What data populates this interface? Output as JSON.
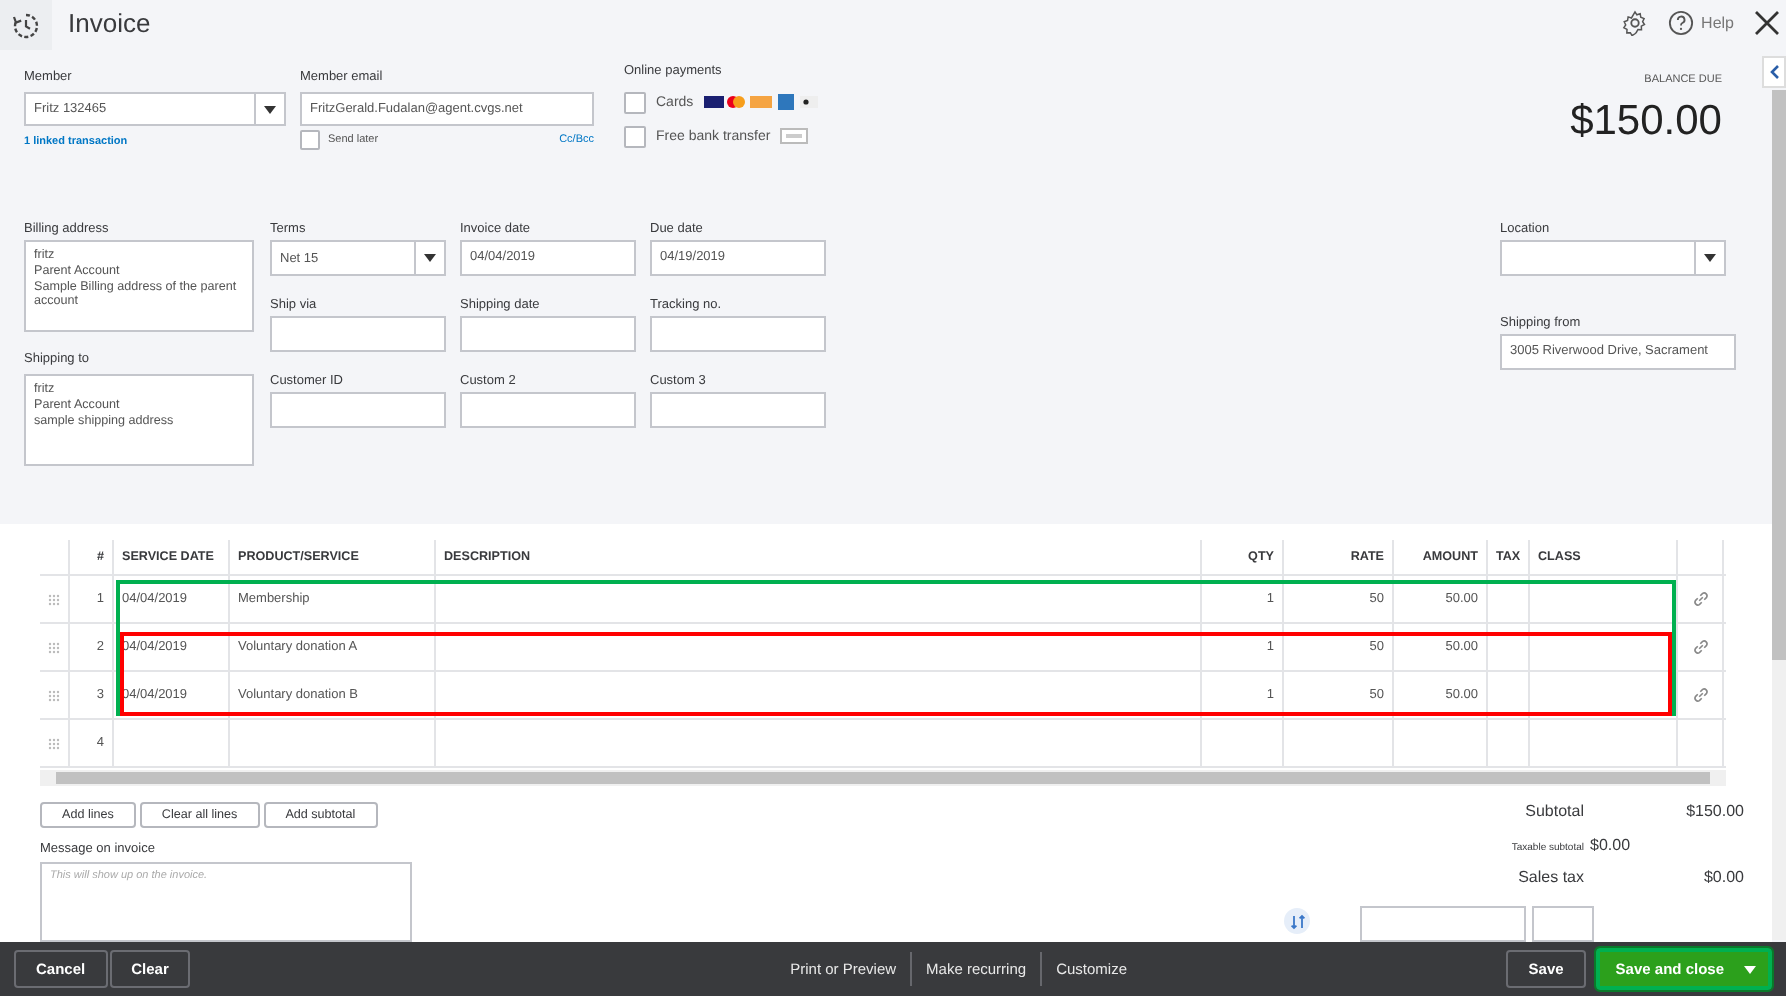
{
  "header": {
    "title": "Invoice",
    "help": "Help"
  },
  "member": {
    "label": "Member",
    "value": "Fritz 132465",
    "link": "1 linked transaction"
  },
  "email": {
    "label": "Member email",
    "value": "FritzGerald.Fudalan@agent.cvgs.net",
    "send_later": {
      "label": "Send later",
      "checked": false
    },
    "cc_link": "Cc/Bcc"
  },
  "online_payments": {
    "label": "Online payments",
    "options": [
      {
        "label": "Cards",
        "checked": false,
        "kind": "cards"
      },
      {
        "label": "Free bank transfer",
        "checked": false,
        "kind": "bank"
      }
    ]
  },
  "balance_due": {
    "label": "BALANCE DUE",
    "amount": "$150.00"
  },
  "billing_address": {
    "label": "Billing address",
    "lines": [
      "fritz",
      "Parent Account",
      "Sample Billing address of the parent account"
    ]
  },
  "shipping_to": {
    "label": "Shipping to",
    "lines": [
      "fritz",
      "Parent Account",
      "sample shipping address"
    ]
  },
  "fields": [
    {
      "label": "Terms",
      "value": "Net 15",
      "kind": "dropdown"
    },
    {
      "label": "Invoice date",
      "value": "04/04/2019",
      "kind": "text"
    },
    {
      "label": "Due date",
      "value": "04/19/2019",
      "kind": "text"
    },
    {
      "label": "Ship via",
      "kind": "text"
    },
    {
      "label": "Shipping date",
      "kind": "text"
    },
    {
      "label": "Tracking no.",
      "kind": "text"
    },
    {
      "label": "Customer ID",
      "kind": "text"
    },
    {
      "label": "Custom 2",
      "kind": "text"
    },
    {
      "label": "Custom 3",
      "kind": "text"
    }
  ],
  "location": {
    "label": "Location",
    "kind": "dropdown"
  },
  "shipping_from": {
    "label": "Shipping from",
    "value": "3005 Riverwood Drive, Sacrament"
  },
  "table": {
    "columns": [
      "#",
      "SERVICE DATE",
      "PRODUCT/SERVICE",
      "DESCRIPTION",
      "QTY",
      "RATE",
      "AMOUNT",
      "TAX",
      "CLASS"
    ],
    "rows": [
      {
        "number": "1",
        "service_date": "04/04/2019",
        "product": "Membership",
        "qty": "1",
        "rate": "50",
        "amount": "50.00",
        "outlines": [
          {
            "color": "#00b050"
          }
        ]
      },
      {
        "number": "2",
        "service_date": "04/04/2019",
        "product": "Voluntary donation A",
        "qty": "1",
        "rate": "50",
        "amount": "50.00",
        "outlines": [
          {
            "color": "#00b050"
          },
          {
            "color": "#ff0000"
          }
        ]
      },
      {
        "number": "3",
        "service_date": "04/04/2019",
        "product": "Voluntary donation B",
        "qty": "1",
        "rate": "50",
        "amount": "50.00",
        "outlines": [
          {
            "color": "#00b050"
          },
          {
            "color": "#ff0000"
          }
        ]
      },
      {
        "number": "4"
      }
    ]
  },
  "table_buttons": [
    "Add lines",
    "Clear all lines",
    "Add subtotal"
  ],
  "message": {
    "label": "Message on invoice",
    "placeholder": "This will show up on the invoice."
  },
  "totals": [
    {
      "label": "Subtotal",
      "value": "$150.00",
      "kind": "main"
    },
    {
      "label": "Taxable subtotal",
      "value": "$0.00",
      "kind": "small"
    },
    {
      "label": "Sales tax",
      "value": "$0.00",
      "kind": "main"
    }
  ],
  "footer": {
    "left": [
      "Cancel",
      "Clear"
    ],
    "center": [
      "Print or Preview",
      "Make recurring",
      "Customize"
    ],
    "save": "Save",
    "save_close": "Save and close"
  }
}
